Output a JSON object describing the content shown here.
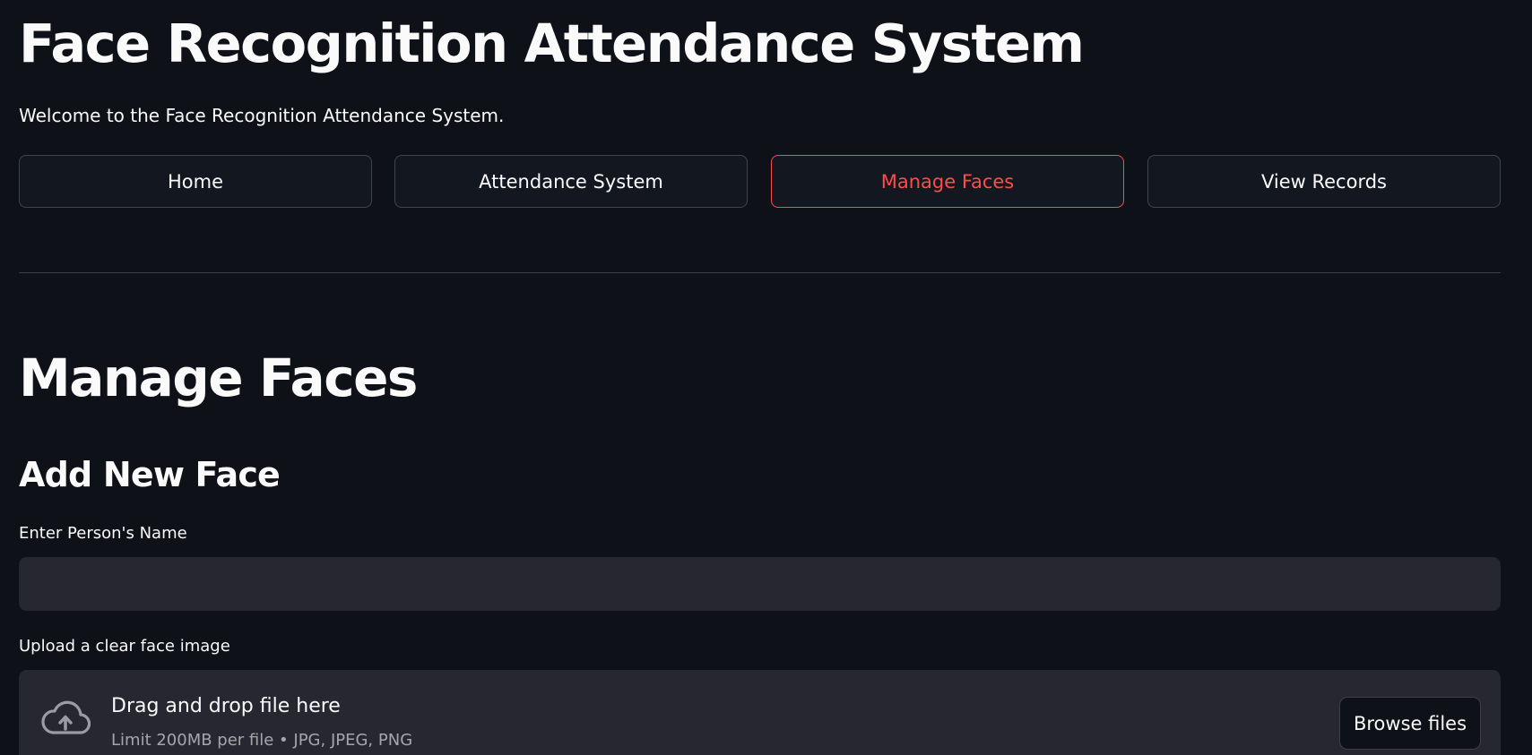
{
  "header": {
    "title": "Face Recognition Attendance System",
    "welcome": "Welcome to the Face Recognition Attendance System."
  },
  "nav": {
    "items": [
      {
        "label": "Home"
      },
      {
        "label": "Attendance System"
      },
      {
        "label": "Manage Faces"
      },
      {
        "label": "View Records"
      }
    ],
    "active": "Manage Faces"
  },
  "main": {
    "title": "Manage Faces",
    "subtitle": "Add New Face",
    "name_field": {
      "label": "Enter Person's Name",
      "value": "",
      "placeholder": ""
    },
    "uploader": {
      "label": "Upload a clear face image",
      "dropzone_text": "Drag and drop file here",
      "limit_text": "Limit 200MB per file • JPG, JPEG, PNG",
      "browse_label": "Browse files",
      "icon": "cloud-upload-icon"
    }
  },
  "theme": {
    "background": "#0e1117",
    "accent": "#ff4b4b",
    "input_background": "#262730",
    "text": "#fafafa"
  }
}
